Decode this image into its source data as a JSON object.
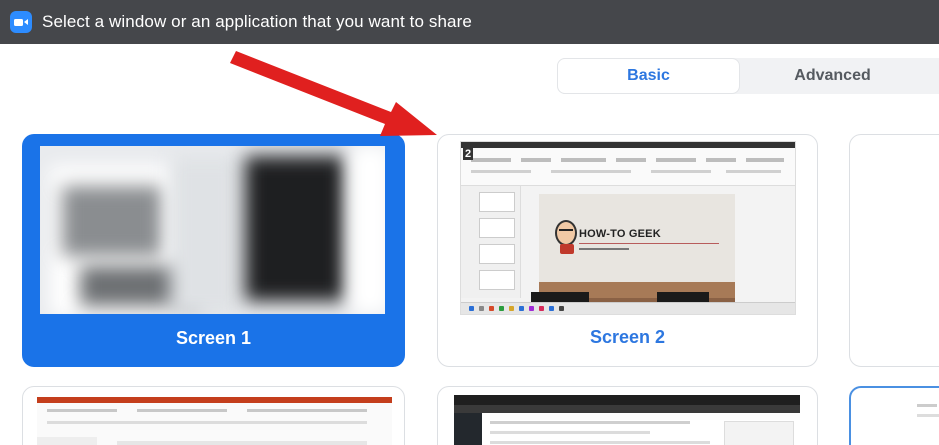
{
  "window": {
    "title": "Select a window or an application that you want to share"
  },
  "tabs": [
    {
      "label": "Basic",
      "selected": true
    },
    {
      "label": "Advanced",
      "selected": false
    }
  ],
  "tiles": [
    {
      "label": "Screen 1",
      "selected": true
    },
    {
      "label": "Screen 2",
      "selected": false,
      "thumbnail": {
        "badge": "2",
        "slide_title": "HOW-TO GEEK"
      }
    }
  ],
  "colors": {
    "titlebar": "#45474b",
    "accent": "#2d8cff",
    "selected_tile": "#1a73e8",
    "tab_text_active": "#2d77e0",
    "tab_text_inactive": "#555a60",
    "annotation_arrow": "#e0201f"
  },
  "icons": {
    "app": "video-camera-icon"
  }
}
